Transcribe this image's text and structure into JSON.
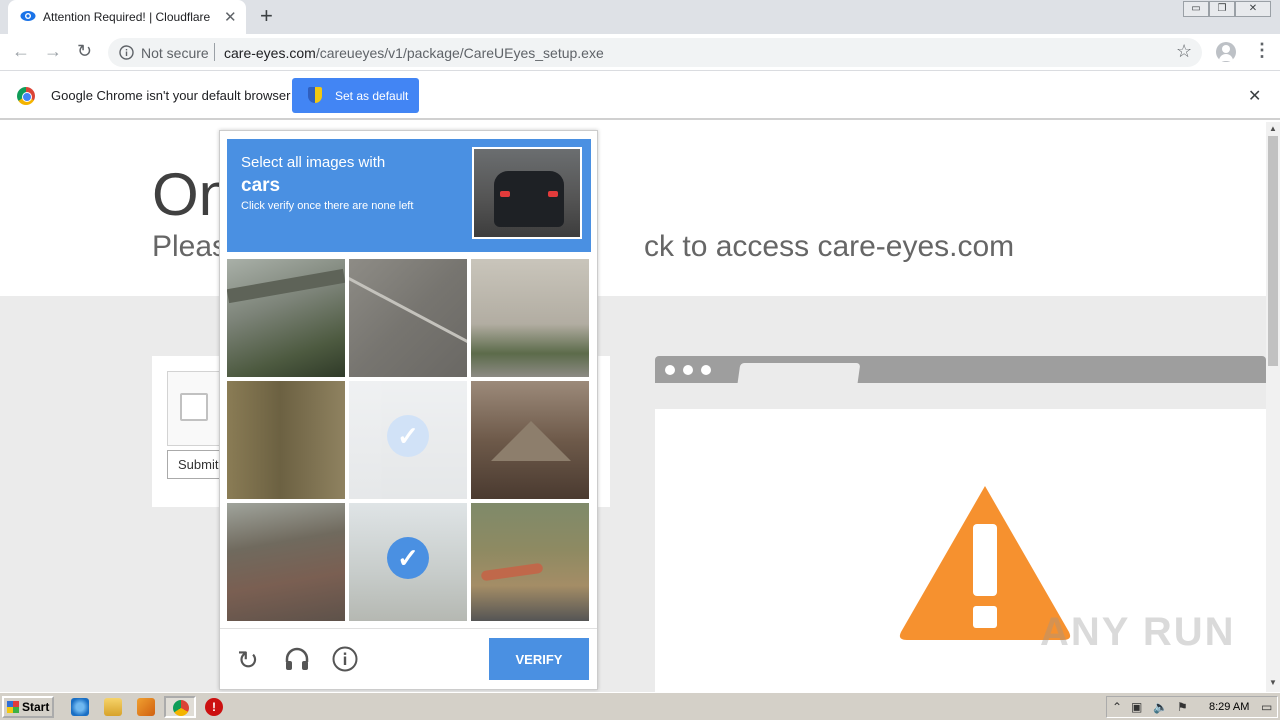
{
  "browser": {
    "tab_title": "Attention Required! | Cloudflare",
    "not_secure": "Not secure",
    "url_host": "care-eyes.com",
    "url_path": "/careueyes/v1/package/CareUEyes_setup.exe",
    "icons": [
      "eye-icon",
      "close-icon",
      "plus-icon",
      "back-icon",
      "forward-icon",
      "reload-icon",
      "info-icon",
      "star-icon",
      "avatar-icon",
      "menu-icon"
    ]
  },
  "infobar": {
    "message": "Google Chrome isn't your default browser",
    "button_label": "Set as default"
  },
  "page": {
    "heading": "On",
    "subheading_left": "Pleas",
    "subheading_right": "ck to access care-eyes.com",
    "submit_label": "Submit"
  },
  "captcha": {
    "prompt_line1": "Select all images with",
    "prompt_target": "cars",
    "prompt_line2": "Click verify once there are none left",
    "verify_label": "VERIFY",
    "selected_tiles": [
      4,
      7
    ],
    "icons": [
      "reload-icon",
      "audio-icon",
      "info-icon"
    ]
  },
  "taskbar": {
    "start_label": "Start",
    "clock": "8:29 AM"
  },
  "watermark": "ANY RUN",
  "colors": {
    "captcha_blue": "#4a90e2",
    "chrome_blue": "#4285f4",
    "warning_orange": "#f6912f"
  }
}
